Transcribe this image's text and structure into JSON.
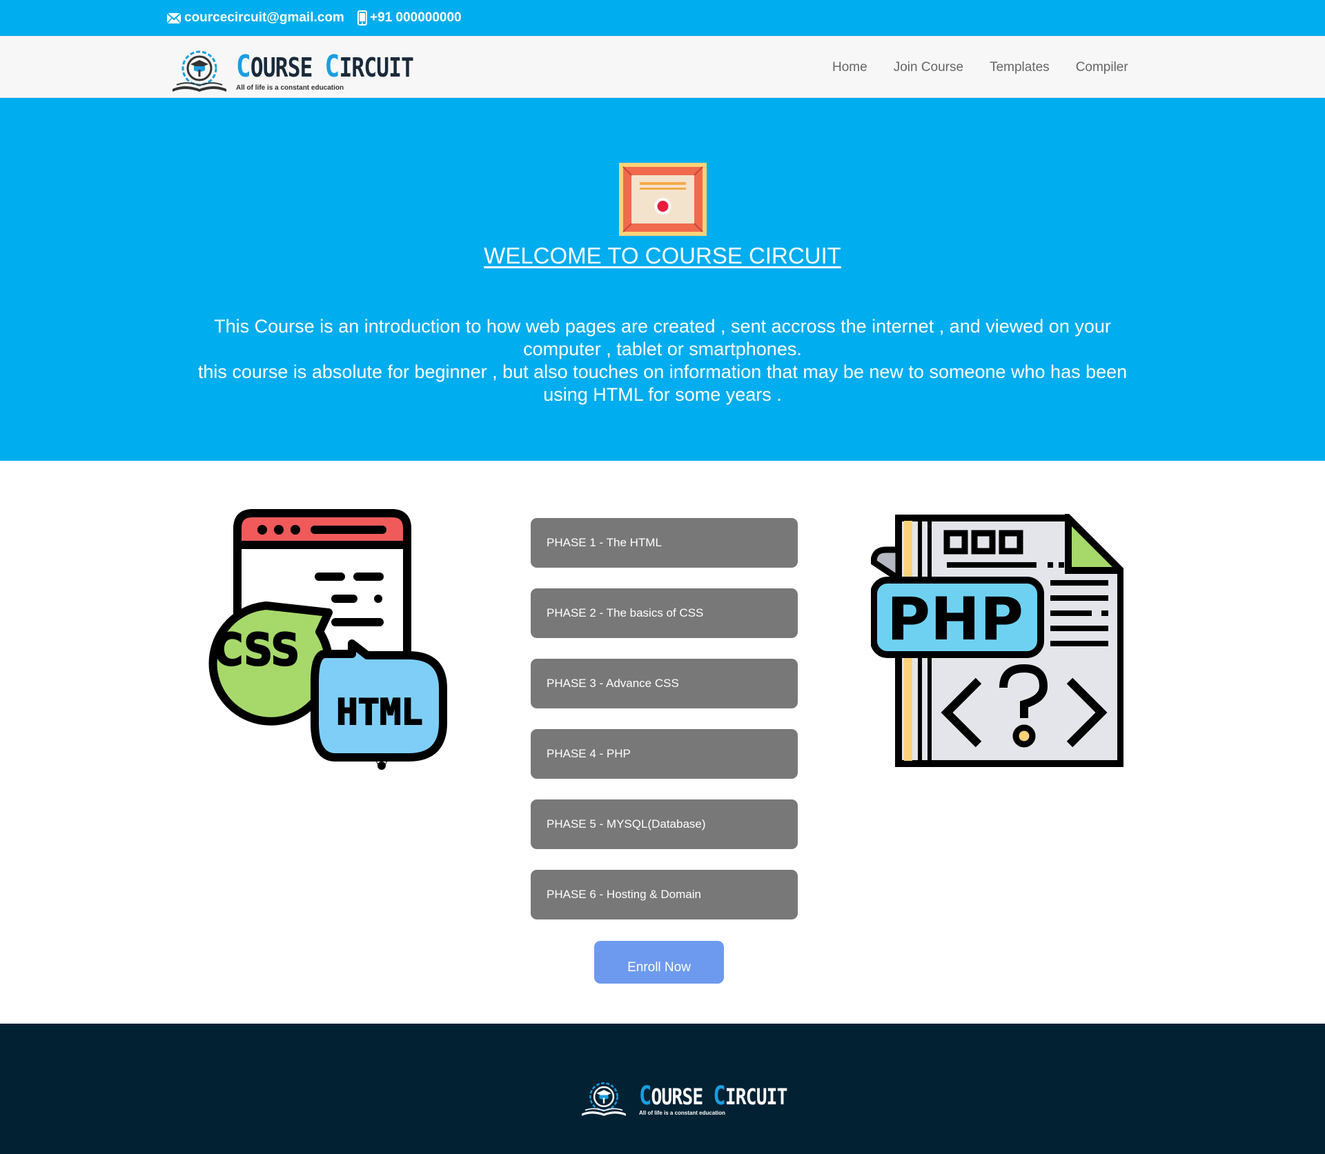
{
  "topbar": {
    "email": "courcecircuit@gmail.com",
    "phone": "+91 000000000"
  },
  "brand": {
    "name_first_initial": "C",
    "name_first_rest": "OURSE",
    "name_second_initial": "C",
    "name_second_rest": "IRCUIT",
    "tagline": "All of life is a constant education"
  },
  "nav": {
    "items": [
      "Home",
      "Join Course",
      "Templates",
      "Compiler"
    ]
  },
  "hero": {
    "title": "WELCOME TO COURSE CIRCUIT",
    "line1": "This Course is an introduction to how web pages are created , sent accross the internet , and viewed on your computer , tablet or smartphones.",
    "line2": "this course is absolute for beginner , but also touches on information that may be new to someone who has been using HTML for some years ."
  },
  "illustrations": {
    "left_bubble1": "CSS",
    "left_bubble2": "HTML",
    "right_label": "PHP"
  },
  "phases": [
    "PHASE 1 - The HTML",
    "PHASE 2 - The basics of CSS",
    "PHASE 3 - Advance CSS",
    "PHASE 4 - PHP",
    "PHASE 5 - MYSQL(Database)",
    "PHASE 6 - Hosting & Domain"
  ],
  "cta": {
    "enroll_label": "Enroll Now"
  },
  "colors": {
    "primary_blue": "#00adef",
    "phase_gray": "#787878",
    "enroll_blue": "#6d9aee",
    "footer_navy": "#022234",
    "logo_blue": "#1a9ee0"
  }
}
